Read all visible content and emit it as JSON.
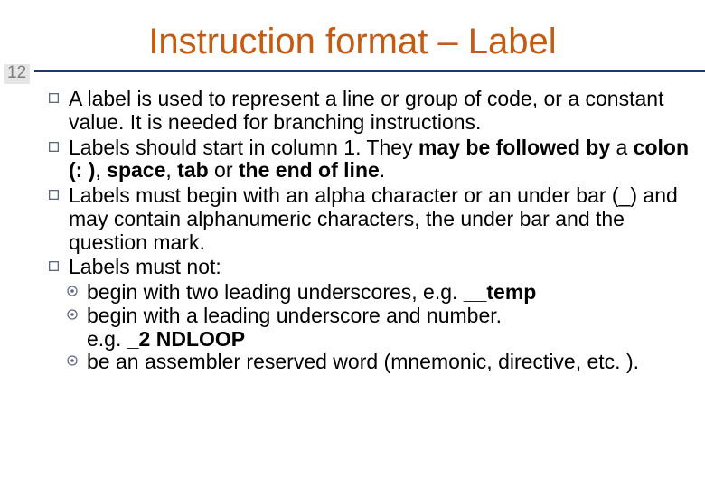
{
  "title": "Instruction format – Label",
  "page_number": "12",
  "bullets": {
    "b0": "A label is used to represent a line or group of code, or a constant value. It is needed for branching instructions.",
    "b1_pre": " Labels should start in column 1. They ",
    "b1_bold": "may be followed by",
    "b1_mid1": " a ",
    "b1_bold2": "colon (: )",
    "b1_mid2": ", ",
    "b1_bold3": "space",
    "b1_mid3": ", ",
    "b1_bold4": "tab",
    "b1_mid4": " or ",
    "b1_bold5": "the end of line",
    "b1_post": ".",
    "b2": "Labels must begin with an alpha character or an under bar (_) and may contain alphanumeric characters, the under bar and the question mark.",
    "b3": "Labels must not:"
  },
  "subs": {
    "s0_pre": "begin with two leading underscores, e.g.    ",
    "s0_bold": "__temp",
    "s1": "begin with a leading underscore and number.",
    "s1c_pre": "e.g.   ",
    "s1c_bold": "_2 NDLOOP",
    "s2": "be an assembler reserved word (mnemonic, directive, etc. )."
  }
}
